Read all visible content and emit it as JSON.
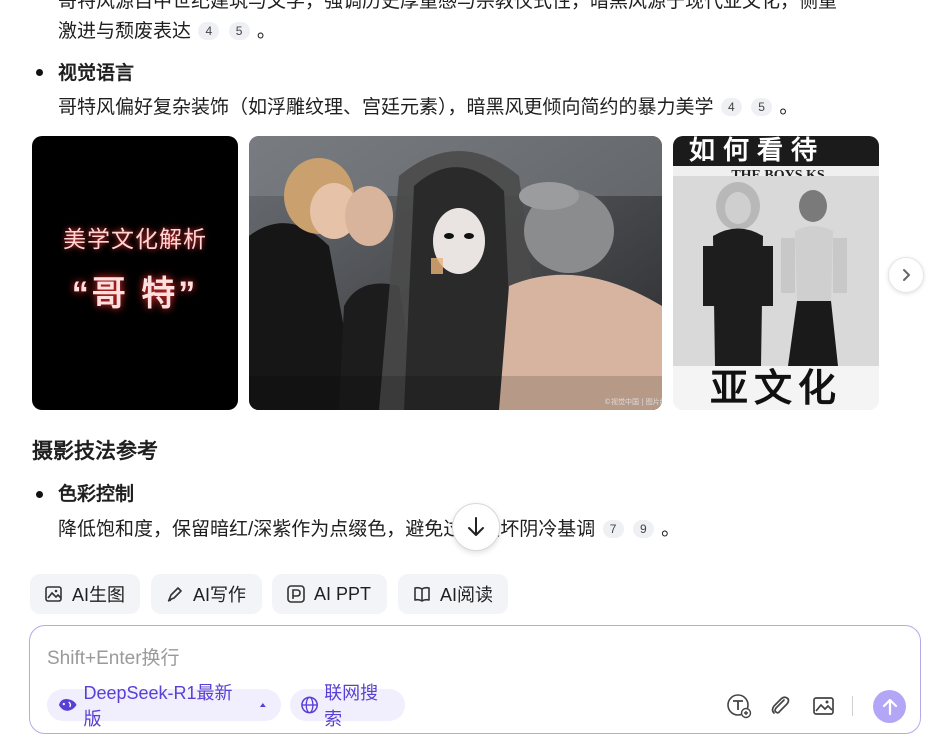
{
  "content": {
    "p0_line1": "哥特风源自中世纪建筑与文学，强调历史厚重感与宗教仪式性，暗黑风源于现代亚文化，侧重",
    "p0_line2": "激进与颓废表达",
    "p0_cites": [
      "4",
      "5"
    ],
    "bullet1_title": "视觉语言",
    "bullet1_text": "哥特风偏好复杂装饰（如浮雕纹理、宫廷元素），暗黑风更倾向简约的暴力美学",
    "bullet1_cites": [
      "4",
      "5"
    ],
    "section_title": "摄影技法参考",
    "bullet2_title": "色彩控制",
    "bullet2_text": "降低饱和度，保留暗红/深紫作为点缀色，避免过度破坏阴冷基调",
    "bullet2_cites": [
      "7",
      "9"
    ],
    "period": "。"
  },
  "images": {
    "card1_line1": "美学文化解析",
    "card1_line2": "“哥 特”",
    "card2_watermark": "©视觉中国 | 图片编号",
    "card3_top": "如何看待",
    "card3_band": "THE BOYS  KS",
    "card3_bottom": "亚文化"
  },
  "tools": [
    {
      "label": "AI生图",
      "icon": "image-gen-icon"
    },
    {
      "label": "AI写作",
      "icon": "pen-icon"
    },
    {
      "label": "AI PPT",
      "icon": "ppt-icon"
    },
    {
      "label": "AI阅读",
      "icon": "book-icon"
    }
  ],
  "input": {
    "placeholder": "Shift+Enter换行",
    "model_label": "DeepSeek-R1最新版",
    "search_label": "联网搜索"
  },
  "colors": {
    "accent": "#5a3fd6",
    "send": "#b4a6f6",
    "border": "#b7a8ee"
  }
}
